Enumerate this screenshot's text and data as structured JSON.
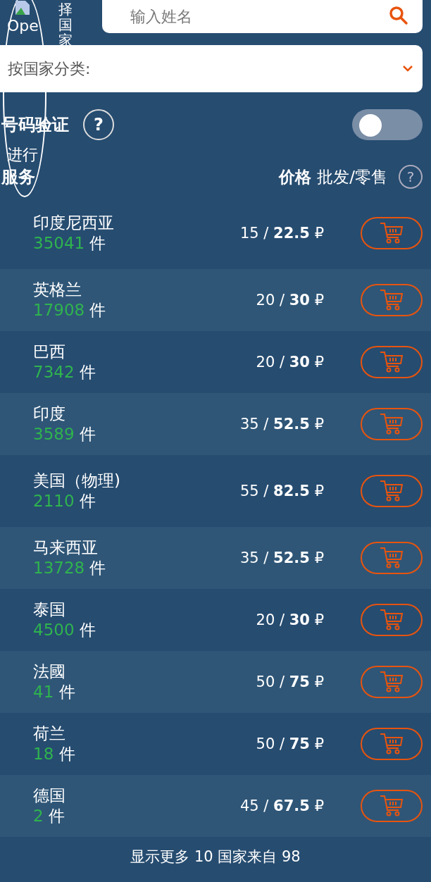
{
  "header": {
    "logo_alt": "Ope",
    "country_label": "择国家"
  },
  "search": {
    "placeholder": "输入姓名"
  },
  "category_select": {
    "value": "按国家分类:"
  },
  "verification": {
    "label": "号码验证",
    "help": "?",
    "toggle_on": false
  },
  "side_texts": [
    "进行",
    "服务"
  ],
  "price_header": {
    "title": "价格",
    "subtitle": "批发/零售",
    "help": "?"
  },
  "countries": [
    {
      "name": "印度尼西亚",
      "count": "35041",
      "unit": "件",
      "wholesale": "15",
      "separator": "/",
      "retail": "22.5",
      "currency": "₽"
    },
    {
      "name": "英格兰",
      "count": "17908",
      "unit": "件",
      "wholesale": "20",
      "separator": "/",
      "retail": "30",
      "currency": "₽"
    },
    {
      "name": "巴西",
      "count": "7342",
      "unit": "件",
      "wholesale": "20",
      "separator": "/",
      "retail": "30",
      "currency": "₽"
    },
    {
      "name": "印度",
      "count": "3589",
      "unit": "件",
      "wholesale": "35",
      "separator": "/",
      "retail": "52.5",
      "currency": "₽"
    },
    {
      "name": "美国（物理)",
      "count": "2110",
      "unit": "件",
      "wholesale": "55",
      "separator": "/",
      "retail": "82.5",
      "currency": "₽"
    },
    {
      "name": "马来西亚",
      "count": "13728",
      "unit": "件",
      "wholesale": "35",
      "separator": "/",
      "retail": "52.5",
      "currency": "₽"
    },
    {
      "name": "泰国",
      "count": "4500",
      "unit": "件",
      "wholesale": "20",
      "separator": "/",
      "retail": "30",
      "currency": "₽"
    },
    {
      "name": "法國",
      "count": "41",
      "unit": "件",
      "wholesale": "50",
      "separator": "/",
      "retail": "75",
      "currency": "₽"
    },
    {
      "name": "荷兰",
      "count": "18",
      "unit": "件",
      "wholesale": "50",
      "separator": "/",
      "retail": "75",
      "currency": "₽"
    },
    {
      "name": "德国",
      "count": "2",
      "unit": "件",
      "wholesale": "45",
      "separator": "/",
      "retail": "67.5",
      "currency": "₽"
    }
  ],
  "show_more": "显示更多 10 国家来自 98"
}
